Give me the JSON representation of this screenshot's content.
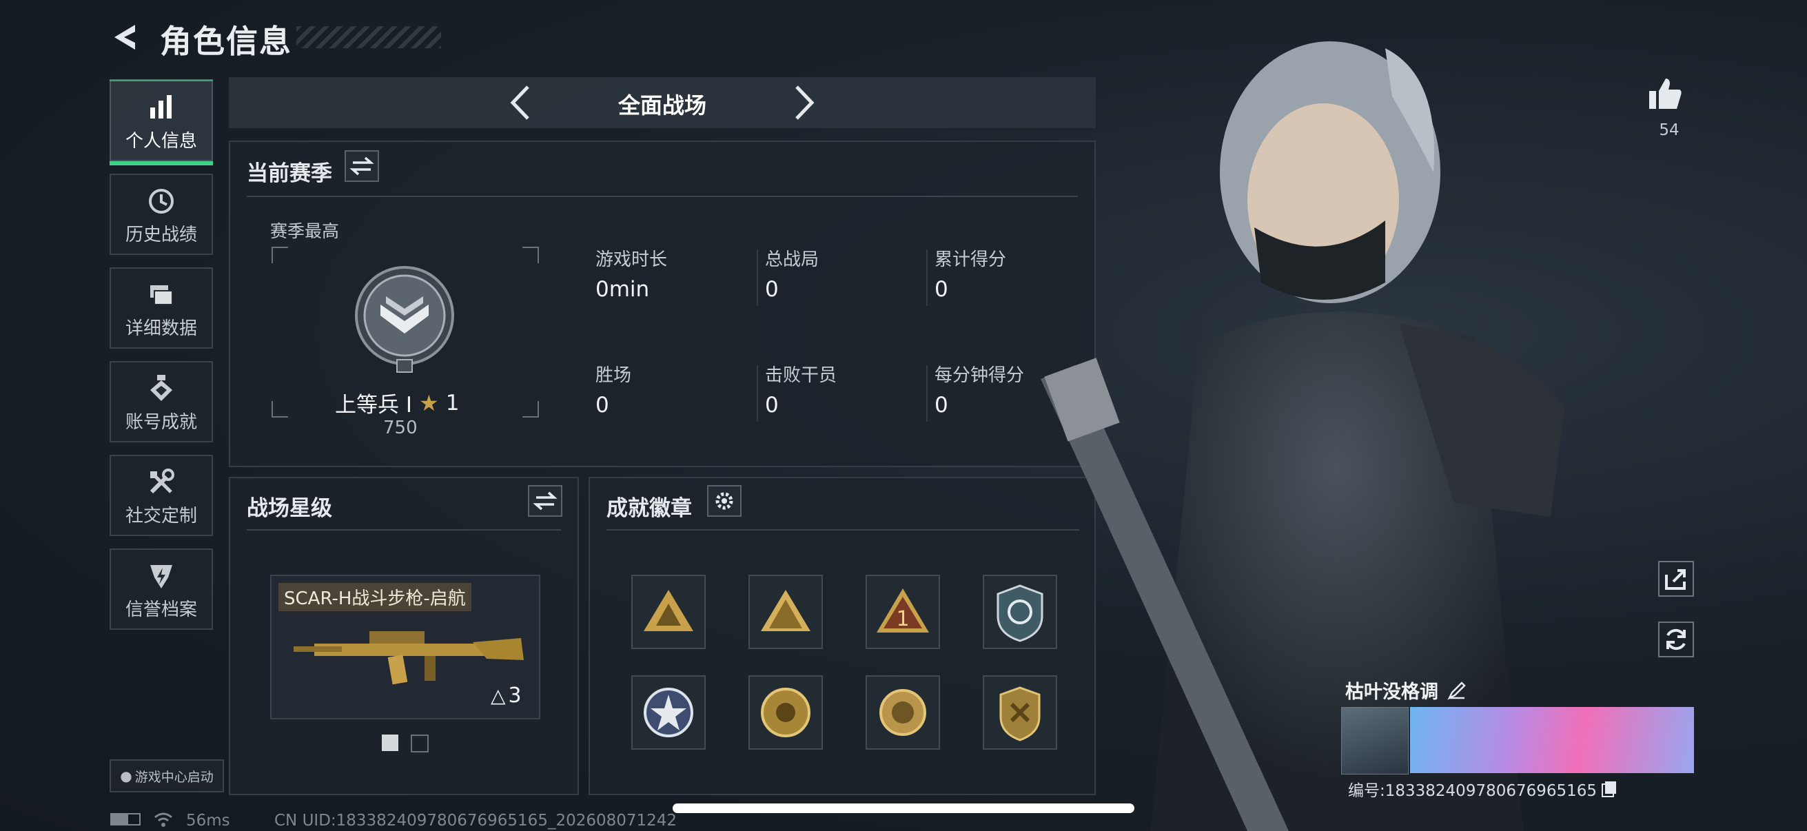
{
  "header": {
    "title": "角色信息"
  },
  "sidebar": {
    "items": [
      {
        "label": "个人信息",
        "icon": "bar-chart-icon",
        "active": true
      },
      {
        "label": "历史战绩",
        "icon": "history-clock-icon",
        "active": false
      },
      {
        "label": "详细数据",
        "icon": "folders-icon",
        "active": false
      },
      {
        "label": "账号成就",
        "icon": "achievement-medal-icon",
        "active": false
      },
      {
        "label": "社交定制",
        "icon": "tools-icon",
        "active": false
      },
      {
        "label": "信誉档案",
        "icon": "credit-badge-icon",
        "active": false
      }
    ],
    "launch_label": "游戏中心启动"
  },
  "mode_selector": {
    "label": "全面战场"
  },
  "season": {
    "title": "当前赛季",
    "best_label": "赛季最高",
    "rank_name": "上等兵 I",
    "rank_stars": "1",
    "rank_points": "750",
    "stats": [
      {
        "label": "游戏时长",
        "value": "0min"
      },
      {
        "label": "总战局",
        "value": "0"
      },
      {
        "label": "累计得分",
        "value": "0"
      },
      {
        "label": "胜场",
        "value": "0"
      },
      {
        "label": "击败干员",
        "value": "0"
      },
      {
        "label": "每分钟得分",
        "value": "0"
      }
    ]
  },
  "battlefield_star": {
    "title": "战场星级",
    "weapon_name": "SCAR-H战斗步枪-启航",
    "weapon_level": "3"
  },
  "achievements": {
    "title": "成就徽章",
    "badges": [
      "badge-1",
      "badge-2",
      "badge-3",
      "badge-4",
      "badge-5",
      "badge-6",
      "badge-7",
      "badge-8"
    ]
  },
  "profile": {
    "likes": "54",
    "player_name": "枯叶没格调",
    "player_id": "编号:1833824097806769651​65"
  },
  "footer": {
    "ping": "56ms",
    "uid": "CN UID:183382409780676965165_202608071242"
  },
  "colors": {
    "accent": "#3fd08a",
    "gold": "#c8a14a"
  }
}
